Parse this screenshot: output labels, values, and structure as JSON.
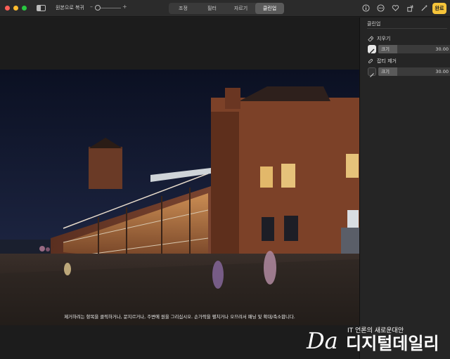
{
  "toolbar": {
    "revert_label": "원본으로 복귀",
    "zoom_minus": "–",
    "zoom_plus": "+",
    "tabs": [
      {
        "label": "조정",
        "active": false
      },
      {
        "label": "필터",
        "active": false
      },
      {
        "label": "자르기",
        "active": false
      },
      {
        "label": "클린업",
        "active": true
      }
    ],
    "right_icons": [
      "info-icon",
      "more-icon",
      "heart-icon",
      "rotate-icon",
      "magic-wand-icon"
    ],
    "done_label": "완료"
  },
  "canvas": {
    "hint": "제거하려는 항목을 클릭하거나, 문지르거나, 주변에 원을 그리십시오. 손가락을 펼치거나 오므려서 패닝 및 확대/축소합니다."
  },
  "panel": {
    "title": "클린업",
    "erase": {
      "label": "지우기",
      "size_label": "크기",
      "size_value": "30.00",
      "size_fraction": 0.26,
      "brush_selected": true
    },
    "retouch": {
      "label": "잡티 제거",
      "size_label": "크기",
      "size_value": "30.00",
      "size_fraction": 0.26,
      "brush_selected": false
    }
  },
  "watermark": {
    "sub": "IT 언론의 새로운대안",
    "logo": "Da",
    "name": "디지털데일리"
  },
  "colors": {
    "accent": "#f5c43a",
    "sky": "#0d1226",
    "brick": "#8a4a2c"
  }
}
